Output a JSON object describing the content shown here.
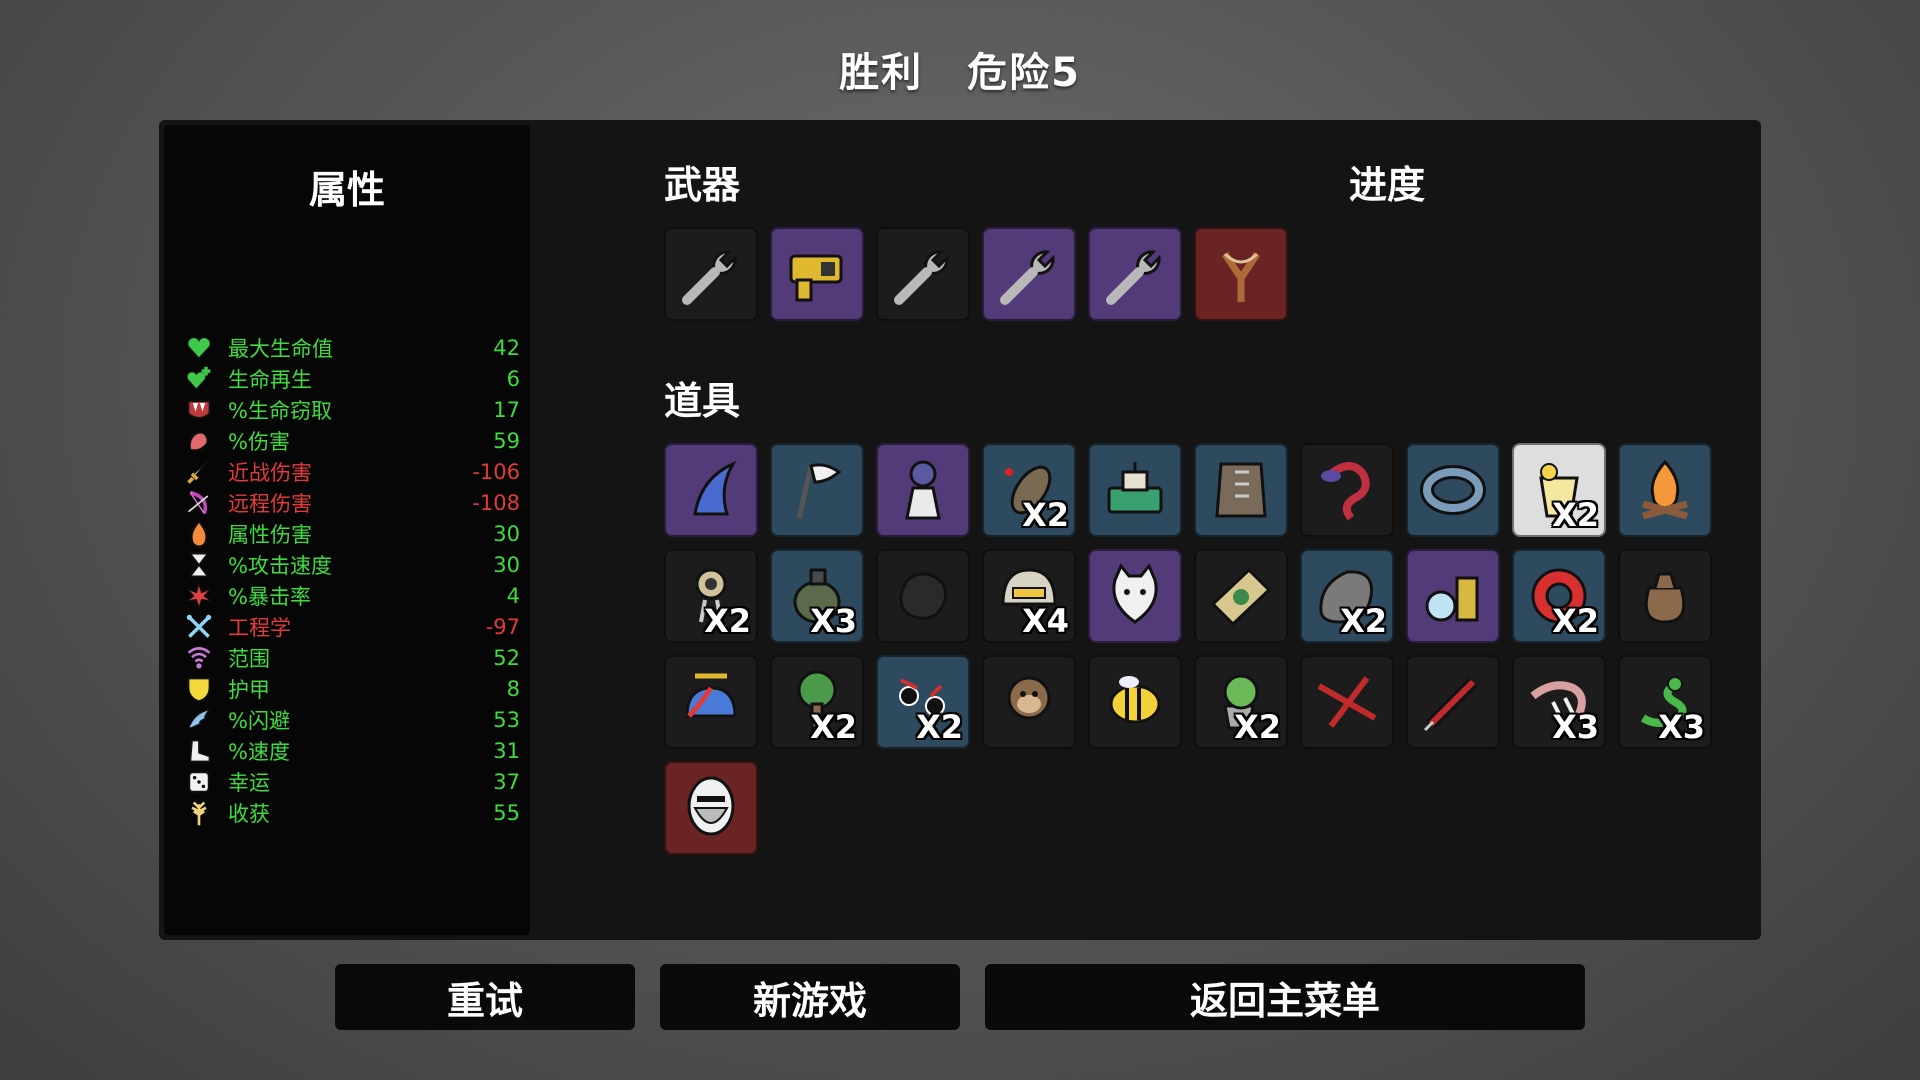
{
  "header": {
    "result": "胜利",
    "danger": "危险5"
  },
  "stats": {
    "title": "属性",
    "rows": [
      {
        "icon": "heart-icon",
        "label": "最大生命值",
        "value": "42",
        "status": "positive"
      },
      {
        "icon": "heart-plus-icon",
        "label": "生命再生",
        "value": "6",
        "status": "positive"
      },
      {
        "icon": "fangs-icon",
        "label": "%生命窃取",
        "value": "17",
        "status": "positive"
      },
      {
        "icon": "muscle-icon",
        "label": "%伤害",
        "value": "59",
        "status": "positive"
      },
      {
        "icon": "sword-icon",
        "label": "近战伤害",
        "value": "-106",
        "status": "negative"
      },
      {
        "icon": "bow-icon",
        "label": "远程伤害",
        "value": "-108",
        "status": "negative"
      },
      {
        "icon": "flame-icon",
        "label": "属性伤害",
        "value": "30",
        "status": "positive"
      },
      {
        "icon": "hourglass-icon",
        "label": "%攻击速度",
        "value": "30",
        "status": "positive"
      },
      {
        "icon": "crit-burst-icon",
        "label": "%暴击率",
        "value": "4",
        "status": "positive"
      },
      {
        "icon": "crossed-wrenches-icon",
        "label": "工程学",
        "value": "-97",
        "status": "negative"
      },
      {
        "icon": "range-signal-icon",
        "label": "范围",
        "value": "52",
        "status": "positive"
      },
      {
        "icon": "shield-icon",
        "label": "护甲",
        "value": "8",
        "status": "positive"
      },
      {
        "icon": "dodge-wing-icon",
        "label": "%闪避",
        "value": "53",
        "status": "positive"
      },
      {
        "icon": "boot-icon",
        "label": "%速度",
        "value": "31",
        "status": "positive"
      },
      {
        "icon": "dice-icon",
        "label": "幸运",
        "value": "37",
        "status": "positive"
      },
      {
        "icon": "wheat-icon",
        "label": "收获",
        "value": "55",
        "status": "positive"
      }
    ]
  },
  "weapons": {
    "title": "武器",
    "items": [
      {
        "icon": "wrench-icon",
        "rarity": "common",
        "count": ""
      },
      {
        "icon": "taser-icon",
        "rarity": "rare",
        "count": ""
      },
      {
        "icon": "wrench-icon",
        "rarity": "common",
        "count": ""
      },
      {
        "icon": "wrench-icon",
        "rarity": "rare",
        "count": ""
      },
      {
        "icon": "wrench-icon",
        "rarity": "rare",
        "count": ""
      },
      {
        "icon": "slingshot-icon",
        "rarity": "legend",
        "count": ""
      }
    ]
  },
  "progress": {
    "title": "进度"
  },
  "items": {
    "title": "道具",
    "list": [
      {
        "icon": "shark-fin-icon",
        "rarity": "rare",
        "count": ""
      },
      {
        "icon": "white-flag-icon",
        "rarity": "uncommon",
        "count": ""
      },
      {
        "icon": "hooded-figure-icon",
        "rarity": "rare",
        "count": ""
      },
      {
        "icon": "larva-icon",
        "rarity": "uncommon",
        "count": "X2"
      },
      {
        "icon": "turret-machine-icon",
        "rarity": "uncommon",
        "count": ""
      },
      {
        "icon": "leather-vest-icon",
        "rarity": "uncommon",
        "count": ""
      },
      {
        "icon": "tongue-icon",
        "rarity": "common",
        "count": ""
      },
      {
        "icon": "ring-icon",
        "rarity": "uncommon",
        "count": ""
      },
      {
        "icon": "lemonade-icon",
        "rarity": "white",
        "count": "X2"
      },
      {
        "icon": "campfire-icon",
        "rarity": "uncommon",
        "count": ""
      },
      {
        "icon": "robot-arm-icon",
        "rarity": "common",
        "count": "X2"
      },
      {
        "icon": "grenade-icon",
        "rarity": "uncommon",
        "count": "X3"
      },
      {
        "icon": "coal-icon",
        "rarity": "common",
        "count": ""
      },
      {
        "icon": "helmet-icon",
        "rarity": "common",
        "count": "X4"
      },
      {
        "icon": "cat-icon",
        "rarity": "rare",
        "count": ""
      },
      {
        "icon": "banknote-icon",
        "rarity": "common",
        "count": ""
      },
      {
        "icon": "stone-icon",
        "rarity": "uncommon",
        "count": "X2"
      },
      {
        "icon": "lab-flask-icon",
        "rarity": "rare",
        "count": ""
      },
      {
        "icon": "lifebuoy-icon",
        "rarity": "uncommon",
        "count": "X2"
      },
      {
        "icon": "loot-sack-icon",
        "rarity": "common",
        "count": ""
      },
      {
        "icon": "propeller-cap-icon",
        "rarity": "common",
        "count": ""
      },
      {
        "icon": "tree-icon",
        "rarity": "common",
        "count": "X2"
      },
      {
        "icon": "bloody-eyes-icon",
        "rarity": "uncommon",
        "count": "X2"
      },
      {
        "icon": "monkey-icon",
        "rarity": "common",
        "count": ""
      },
      {
        "icon": "bee-icon",
        "rarity": "common",
        "count": ""
      },
      {
        "icon": "plant-pot-icon",
        "rarity": "common",
        "count": "X2"
      },
      {
        "icon": "scar-icon",
        "rarity": "common",
        "count": ""
      },
      {
        "icon": "syringe-icon",
        "rarity": "common",
        "count": ""
      },
      {
        "icon": "fossil-bones-icon",
        "rarity": "common",
        "count": "X3"
      },
      {
        "icon": "snake-icon",
        "rarity": "common",
        "count": "X3"
      },
      {
        "icon": "bearded-egg-icon",
        "rarity": "legend",
        "count": ""
      }
    ]
  },
  "buttons": {
    "retry": "重试",
    "new_game": "新游戏",
    "main_menu": "返回主菜单"
  },
  "colors": {
    "positive": "#3fdc3f",
    "negative": "#e23a3a",
    "common": "#1c1c1c",
    "uncommon": "#2e4a5e",
    "rare": "#533a78",
    "legend": "#6a2424",
    "white": "#dedede"
  }
}
